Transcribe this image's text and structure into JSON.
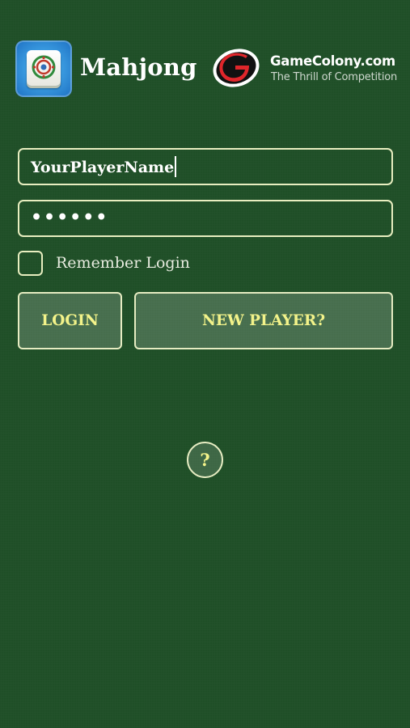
{
  "header": {
    "app_icon": "mahjong-tile-icon",
    "app_title": "Mahjong",
    "brand_logo": "gamecolony-logo-icon",
    "brand_name": "GameColony.com",
    "brand_tagline": "The Thrill of Competition"
  },
  "login_form": {
    "username_value": "YourPlayerName",
    "password_value": "••••••",
    "remember_label": "Remember Login",
    "remember_checked": false,
    "login_label": "LOGIN",
    "new_player_label": "NEW PLAYER?"
  },
  "help": {
    "label": "?"
  },
  "colors": {
    "background": "#1f4f27",
    "border": "#e8eec0",
    "button_text": "#f3f38a"
  }
}
